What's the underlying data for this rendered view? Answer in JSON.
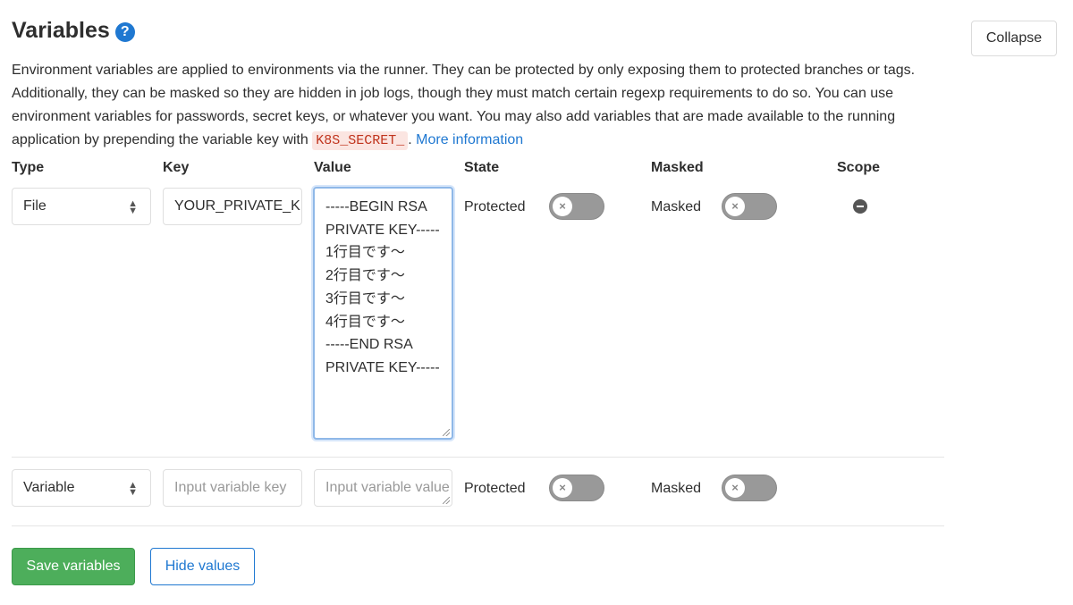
{
  "title": "Variables",
  "help_icon": "question-circle-icon",
  "collapse_label": "Collapse",
  "description": {
    "text": "Environment variables are applied to environments via the runner. They can be protected by only exposing them to protected branches or tags. Additionally, they can be masked so they are hidden in job logs, though they must match certain regexp requirements to do so. You can use environment variables for passwords, secret keys, or whatever you want. You may also add variables that are made available to the running application by prepending the variable key with ",
    "code": "K8S_SECRET_",
    "after": ". ",
    "link": "More information"
  },
  "columns": {
    "type": "Type",
    "key": "Key",
    "value": "Value",
    "state": "State",
    "masked": "Masked",
    "scope": "Scope"
  },
  "rows": [
    {
      "type": "File",
      "key": "YOUR_PRIVATE_KEY",
      "value": "-----BEGIN RSA PRIVATE KEY-----\n1行目です～\n2行目です～\n3行目です～\n4行目です～\n-----END RSA PRIVATE KEY-----",
      "protected_label": "Protected",
      "protected": false,
      "masked_label": "Masked",
      "masked": false
    },
    {
      "type": "Variable",
      "key_placeholder": "Input variable key",
      "value_placeholder": "Input variable value",
      "protected_label": "Protected",
      "protected": false,
      "masked_label": "Masked",
      "masked": false
    }
  ],
  "save_label": "Save variables",
  "hide_label": "Hide values",
  "colors": {
    "accent": "#1f78d1",
    "save": "#4dae5b",
    "toggle_off": "#999999"
  }
}
